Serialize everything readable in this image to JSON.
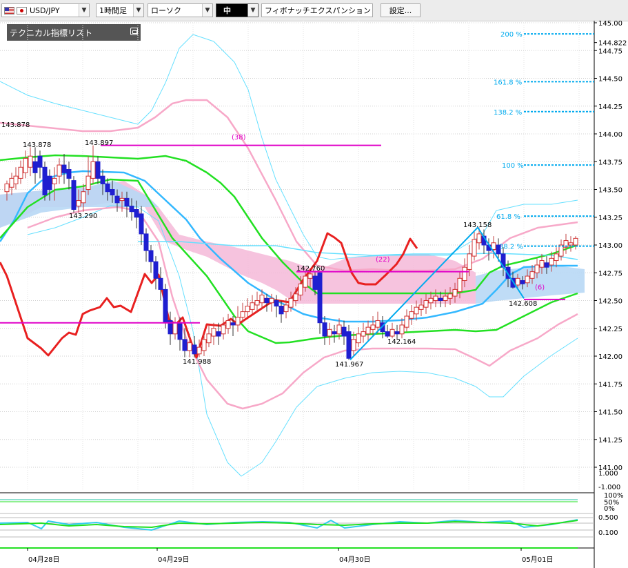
{
  "toolbar": {
    "symbol": "USD/JPY",
    "timeframe": "1時間足",
    "chart_style": "ローソク",
    "line_width": "中",
    "drawing_tool": "フィボナッチエクスパンション",
    "settings_label": "設定..."
  },
  "legend": {
    "title": "テクニカル指標リスト"
  },
  "y_axis": {
    "labels": [
      "145.00",
      "144.822",
      "144.75",
      "144.50",
      "144.25",
      "144.00",
      "143.75",
      "143.50",
      "143.25",
      "143.00",
      "142.75",
      "142.50",
      "142.25",
      "142.00",
      "141.75",
      "141.50",
      "141.25",
      "141.00"
    ],
    "sub_labels": [
      "1.000",
      "-1.000",
      "100%",
      "50%",
      "0%",
      "0.500",
      "0.100"
    ]
  },
  "x_axis": {
    "labels": [
      "04月28日",
      "04月29日",
      "04月30日",
      "05月01日"
    ]
  },
  "price_labels": [
    "143.878",
    "143.878",
    "143.897",
    "143.290",
    "141.988",
    "142.760",
    "141.967",
    "142.164",
    "143.158",
    "142.608"
  ],
  "fib_levels": [
    "200 %",
    "161.8 %",
    "138.2 %",
    "100 %",
    "61.8 %",
    "38.2 %"
  ],
  "counts": [
    "(38)",
    "(22)",
    "(6)"
  ],
  "colors": {
    "up": "#d03030",
    "down": "#1f1fd0",
    "cloud_pink": "#f5b8d8",
    "cloud_blue": "#b8d8f5",
    "fib": "#00aaee",
    "count": "#e000c8"
  },
  "chart_data": {
    "type": "candlestick",
    "symbol": "USD/JPY",
    "timeframe": "1時間足",
    "ylim": [
      141.0,
      145.0
    ],
    "x_labels": [
      "04月28日",
      "04月29日",
      "04月30日",
      "05月01日"
    ],
    "current_price": 144.822,
    "annotated_highs_lows": [
      143.878,
      143.878,
      143.897,
      143.29,
      141.988,
      142.76,
      141.967,
      142.164,
      143.158,
      142.608
    ],
    "fibonacci_expansion_levels": [
      "200 %",
      "161.8 %",
      "138.2 %",
      "100 %",
      "61.8 %",
      "38.2 %"
    ],
    "bar_counts": [
      "(38)",
      "(22)",
      "(6)"
    ]
  }
}
